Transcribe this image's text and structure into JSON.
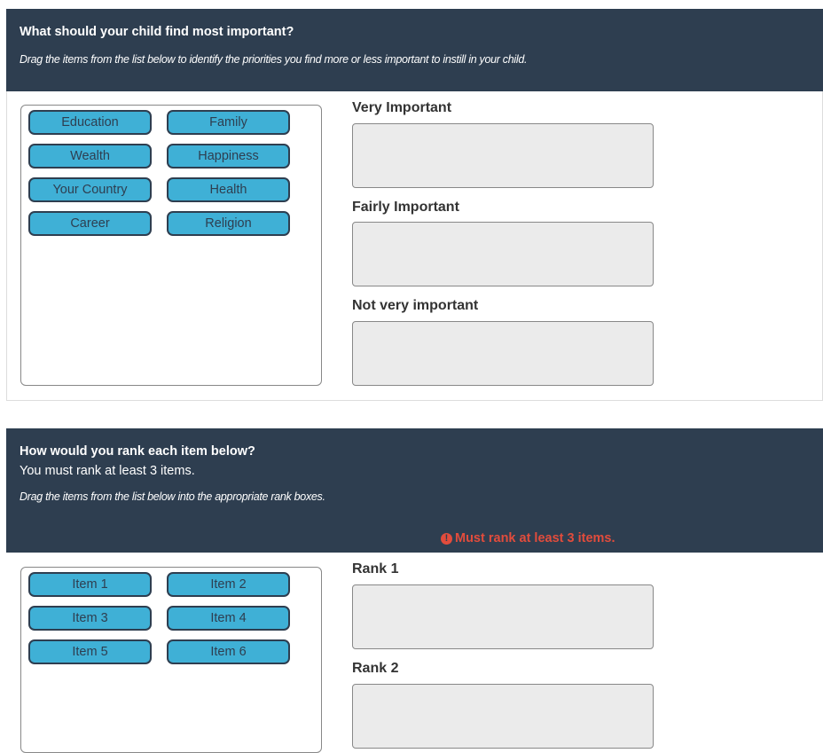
{
  "q1": {
    "title": "What should your child find most important?",
    "instructions": "Drag the items from the list below to identify the priorities you find more or less important to instill in your child.",
    "items": [
      "Education",
      "Family",
      "Wealth",
      "Happiness",
      "Your Country",
      "Health",
      "Career",
      "Religion"
    ],
    "buckets": [
      "Very Important",
      "Fairly Important",
      "Not very important"
    ]
  },
  "q2": {
    "title": "How would you rank each item below?",
    "subtitle": "You must rank at least 3 items.",
    "instructions": "Drag the items from the list below into the appropriate rank boxes.",
    "error": "Must rank at least 3 items.",
    "error_icon": "exclamation-circle-icon",
    "items": [
      "Item 1",
      "Item 2",
      "Item 3",
      "Item 4",
      "Item 5",
      "Item 6"
    ],
    "ranks": [
      "Rank 1",
      "Rank 2"
    ]
  },
  "colors": {
    "header_bg": "#2e3e50",
    "item_bg": "#3fb0d6",
    "error": "#e24c3c",
    "bucket_bg": "#ebebeb"
  }
}
